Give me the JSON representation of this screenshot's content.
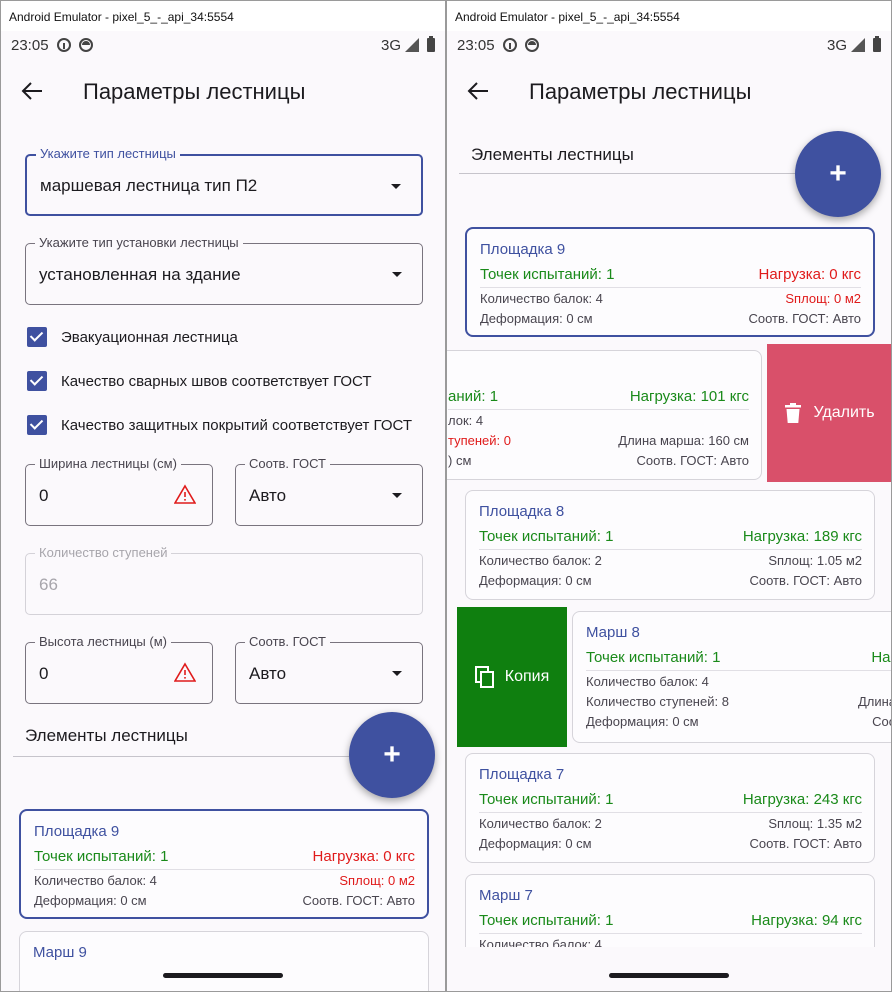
{
  "emulator_title": "Android Emulator - pixel_5_-_api_34:5554",
  "status": {
    "time": "23:05",
    "network": "3G"
  },
  "appbar": {
    "title": "Параметры лестницы"
  },
  "form": {
    "stair_type": {
      "label": "Укажите тип лестницы",
      "value": "маршевая лестница тип П2"
    },
    "install_type": {
      "label": "Укажите тип установки лестницы",
      "value": "установленная на здание"
    },
    "checks": [
      {
        "label": "Эвакуационная лестница",
        "checked": true
      },
      {
        "label": "Качество сварных швов соответствует ГОСТ",
        "checked": true
      },
      {
        "label": "Качество защитных покрытий соответствует ГОСТ",
        "checked": true
      }
    ],
    "width": {
      "label": "Ширина лестницы (см)",
      "value": "0"
    },
    "width_gost": {
      "label": "Соотв. ГОСТ",
      "value": "Авто"
    },
    "steps": {
      "label": "Количество ступеней",
      "value": "66"
    },
    "height": {
      "label": "Высота лестницы (м)",
      "value": "0"
    },
    "height_gost": {
      "label": "Соотв. ГОСТ",
      "value": "Авто"
    }
  },
  "elements_section": {
    "title": "Элементы лестницы",
    "fab": "+"
  },
  "cards": {
    "platform9": {
      "title": "Площадка 9",
      "tests": "Точек испытаний: 1",
      "load": "Нагрузка: 0 кгс",
      "beams": "Количество балок: 4",
      "area": "Sплощ: 0 м2",
      "deform": "Деформация: 0 см",
      "gost": "Соотв. ГОСТ: Авто"
    },
    "march9_title": "Марш 9",
    "march9_swiped": {
      "tests": "аний: 1",
      "load": "Нагрузка: 101 кгс",
      "beams": "лок: 4",
      "steps": "тупеней: 0",
      "length": "Длина марша: 160 см",
      "deform": ") см",
      "gost": "Соотв. ГОСТ: Авто"
    },
    "platform8": {
      "title": "Площадка 8",
      "tests": "Точек испытаний: 1",
      "load": "Нагрузка: 189 кгс",
      "beams": "Количество балок: 2",
      "area": "Sплощ: 1.05 м2",
      "deform": "Деформация: 0 см",
      "gost": "Соотв. ГОСТ: Авто"
    },
    "march8": {
      "title": "Марш 8",
      "tests": "Точек испытаний: 1",
      "load": "Наг",
      "beams": "Количество балок: 4",
      "steps": "Количество ступеней: 8",
      "length": "Длина",
      "deform": "Деформация: 0 см",
      "gost": "Соо"
    },
    "platform7": {
      "title": "Площадка 7",
      "tests": "Точек испытаний: 1",
      "load": "Нагрузка: 243 кгс",
      "beams": "Количество балок: 2",
      "area": "Sплощ: 1.35 м2",
      "deform": "Деформация: 0 см",
      "gost": "Соотв. ГОСТ: Авто"
    },
    "march7": {
      "title": "Марш 7",
      "tests": "Точек испытаний: 1",
      "load": "Нагрузка: 94 кгс",
      "beams": "Количество балок: 4"
    }
  },
  "swipe_actions": {
    "delete": "Удалить",
    "copy": "Копия"
  },
  "colors": {
    "primary": "#3f51a0",
    "delete": "#d9506a",
    "copy": "#0f7f0f",
    "ok": "#1a8a1a",
    "error": "#e01b1b"
  }
}
